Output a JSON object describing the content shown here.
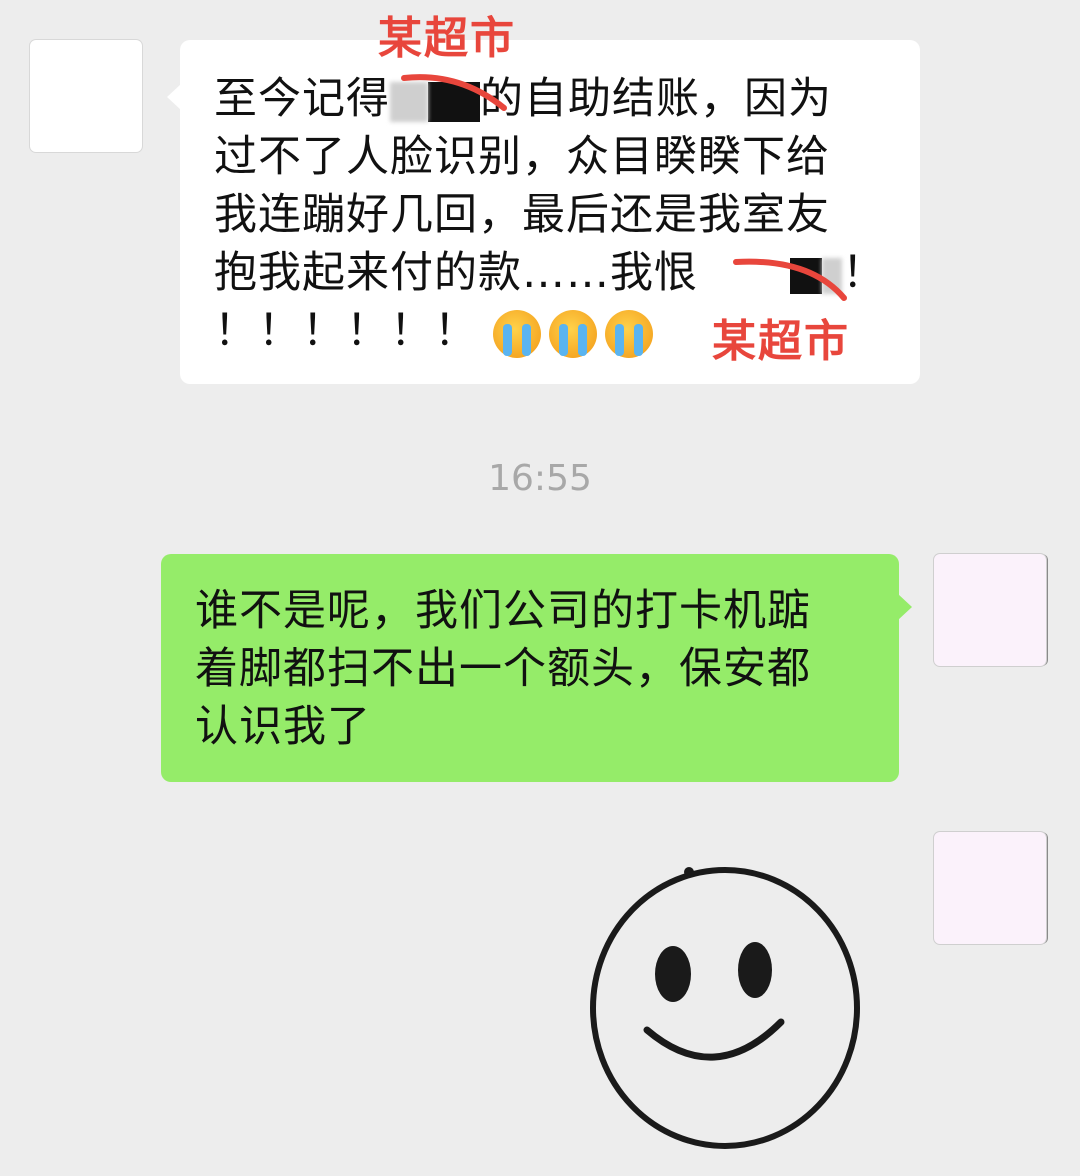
{
  "messages": {
    "incoming": {
      "line1_before": "至今记得",
      "line1_after": "的自助结账，因为",
      "line2": "过不了人脸识别，众目睽睽下给",
      "line3": "我连蹦好几回，最后还是我室友",
      "line4_before": "抱我起来付的款……我恨",
      "line4_after": "！",
      "line5": "！！！！！！",
      "emoji_count": 3,
      "emoji_icon": "loudly-crying-face-icon"
    },
    "timestamp": "16:55",
    "outgoing": {
      "line1": "谁不是呢，我们公司的打卡机踮",
      "line2": "着脚都扫不出一个额头，保安都",
      "line3": "认识我了"
    },
    "sticker": {
      "icon": "smiley-face-icon"
    }
  },
  "annotations": {
    "label_top": "某超市",
    "label_bottom": "某超市",
    "color": "#e8463c"
  },
  "colors": {
    "background": "#ededed",
    "incoming_bubble": "#ffffff",
    "outgoing_bubble": "#95ec69"
  }
}
